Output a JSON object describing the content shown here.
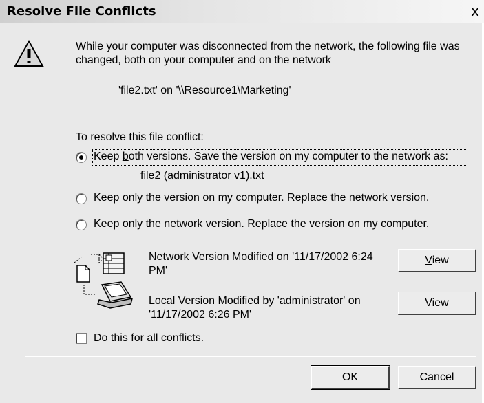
{
  "dialog": {
    "title": "Resolve File Conflicts",
    "close_label": "x"
  },
  "message": {
    "line1": "While your computer was disconnected from the network, the following file was",
    "line2": "changed, both on your computer and on the network",
    "file_path": "'file2.txt' on '\\\\Resource1\\Marketing'"
  },
  "options": {
    "heading": "To resolve this file conflict:",
    "keep_both_pre": "Keep ",
    "keep_both_accel": "b",
    "keep_both_post": "oth versions. Save the version on my computer to the network as:",
    "keep_both_filename": "file2 (administrator v1).txt",
    "keep_both_selected": true,
    "keep_local": "Keep only the version on my computer. Replace the network version.",
    "keep_network_pre": "Keep only the ",
    "keep_network_accel": "n",
    "keep_network_post": "etwork version. Replace the version on my computer."
  },
  "versions": {
    "network_line1": "Network Version Modified on '11/17/2002 6:24",
    "network_line2": "PM'",
    "local_line1": "Local Version Modified by 'administrator' on",
    "local_line2": "'11/17/2002 6:26 PM'",
    "view_network_accel": "V",
    "view_network_rest": "iew",
    "view_local_pre": "Vi",
    "view_local_accel": "e",
    "view_local_post": "w"
  },
  "apply_all": {
    "pre": "Do this for ",
    "accel": "a",
    "post": "ll conflicts.",
    "checked": false
  },
  "buttons": {
    "ok": "OK",
    "cancel": "Cancel"
  },
  "icons": {
    "warning": "warning-icon",
    "sync": "network-sync-icon"
  }
}
